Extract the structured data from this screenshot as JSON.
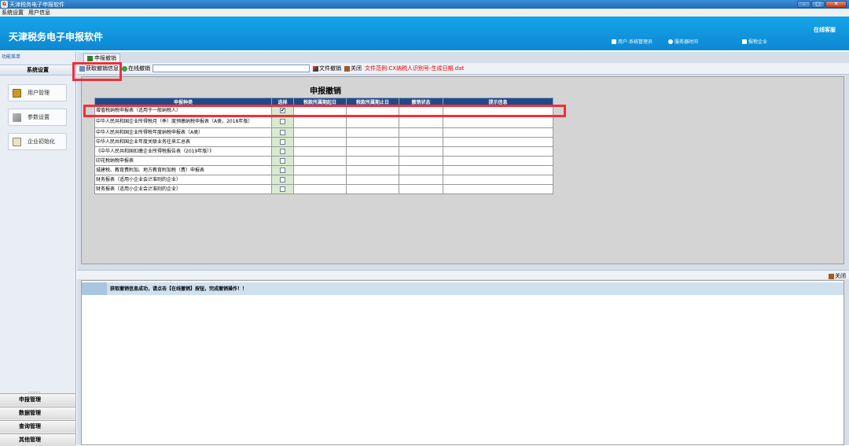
{
  "window": {
    "title": "天津税务电子申报软件",
    "icon_letter": "G"
  },
  "window_controls": {
    "minimize": "–",
    "maximize": "□",
    "close": "✕"
  },
  "menubar": {
    "items": [
      "系统设置",
      "用户信息"
    ]
  },
  "header": {
    "app_title": "天津税务电子申报软件",
    "hotline": "在线客服",
    "user": "用户:系统管理员",
    "server_time": "服务器时间",
    "company": "报税企业"
  },
  "sidebar": {
    "menu_label": "功能菜单",
    "section": "系统设置",
    "buttons": [
      "用户管理",
      "参数设置",
      "企业初始化"
    ],
    "bottom_nav": [
      "申报管理",
      "数据管理",
      "查询管理",
      "其他管理"
    ],
    "dots": "........"
  },
  "tab": {
    "label": "申报撤销"
  },
  "toolbar": {
    "fetch_label": "获取撤销信息",
    "online_label": "在线撤销",
    "file_label": "文件撤销",
    "close_label": "关闭",
    "file_hint": "文件范例:CX纳税人识别号-生成日期.dat"
  },
  "panel": {
    "title": "申报撤销",
    "columns": [
      "申报种类",
      "选择",
      "税款所属期起日",
      "税款所属期止日",
      "撤销状态",
      "提示信息"
    ],
    "rows": [
      {
        "name": "增值税纳税申报表（适用于一般纳税人）",
        "checked": true
      },
      {
        "name": "中华人民共和国企业所得税月（季）度预缴纳税申报表（A类，2018年版）",
        "checked": false
      },
      {
        "name": "中华人民共和国企业所得税年度纳税申报表（A类）",
        "checked": false
      },
      {
        "name": "中华人民共和国企业年度关联业务往来汇总表",
        "checked": false
      },
      {
        "name": "《中华人民共和国扣缴企业所得税报告表（2019年版）》",
        "checked": false
      },
      {
        "name": "印花税纳税申报表",
        "checked": false
      },
      {
        "name": "城建税、教育费附加、地方教育附加税（费）申报表",
        "checked": false
      },
      {
        "name": "财务报表（适用小企业会计准则的企业）",
        "checked": false
      },
      {
        "name": "财务报表（适用小企业会计准则的企业）",
        "checked": false
      }
    ]
  },
  "log": {
    "close_label": "关闭",
    "message": "获取撤销信息成功，请点击【在线撤销】按钮，完成撤销操作！！"
  },
  "colors": {
    "header": "#0e87d3",
    "grid_header": "#204a87",
    "highlight": "#f0303a",
    "hint": "#e00000"
  }
}
